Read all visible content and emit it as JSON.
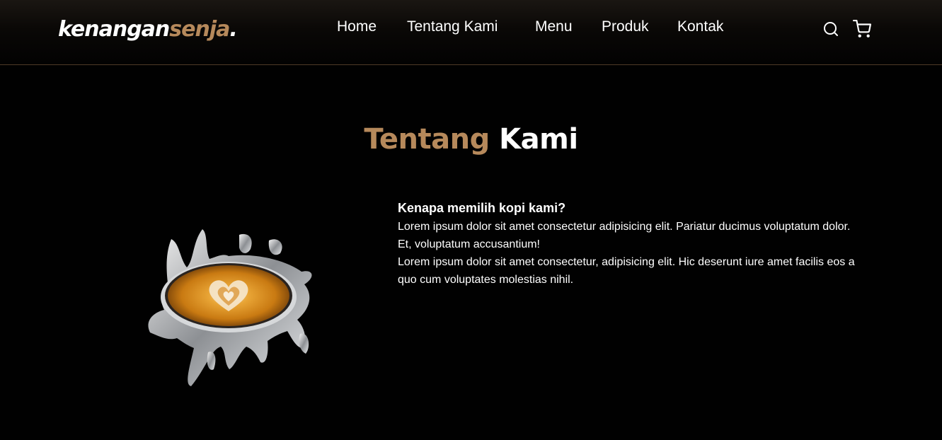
{
  "brand": {
    "part1": "kenangan",
    "part2": "senja",
    "part3": "."
  },
  "nav": {
    "links": [
      "Home",
      "Tentang Kami",
      "Menu",
      "Produk",
      "Kontak"
    ]
  },
  "icons": {
    "search": "search-icon",
    "cart": "shopping-cart-icon"
  },
  "about": {
    "title_accent": "Tentang",
    "title_main": "Kami",
    "image": "coffee-splash-latte-art",
    "heading": "Kenapa memilih kopi kami?",
    "paragraphs": [
      "Lorem ipsum dolor sit amet consectetur adipisicing elit. Pariatur ducimus voluptatum dolor. Et, voluptatum accusantium!",
      "Lorem ipsum dolor sit amet consectetur, adipisicing elit. Hic deserunt iure amet facilis eos a quo cum voluptates molestias nihil."
    ]
  },
  "colors": {
    "accent": "#b6895b",
    "background": "#010101",
    "text": "#ffffff"
  }
}
